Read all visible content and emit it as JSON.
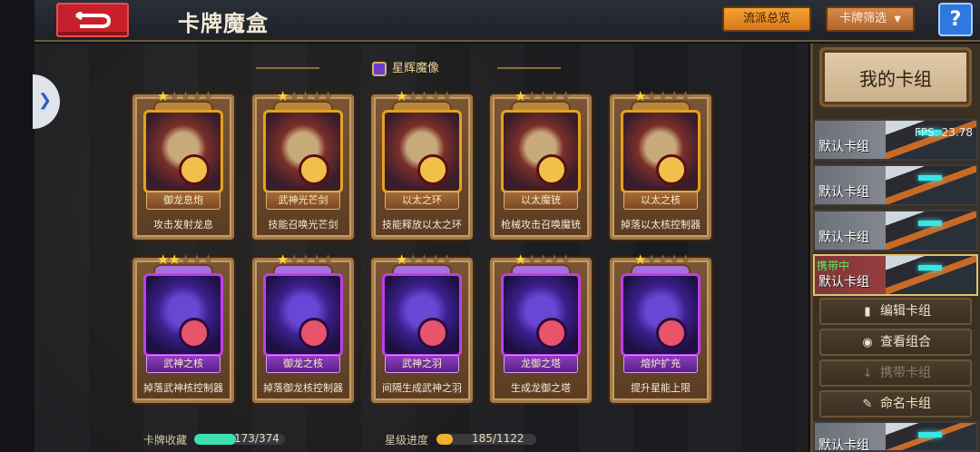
{
  "header": {
    "title": "卡牌魔盒",
    "school_overview_label": "流派总览",
    "card_filter_label": "卡牌筛选",
    "help_label": "?"
  },
  "section": {
    "title": "星辉魔像"
  },
  "cards": [
    {
      "name": "御龙息炮",
      "desc": "攻击发射龙息",
      "stars": 1,
      "rarity": "gold"
    },
    {
      "name": "武神光芒剑",
      "desc": "技能召唤光芒剑",
      "stars": 1,
      "rarity": "gold"
    },
    {
      "name": "以太之环",
      "desc": "技能释放以太之环",
      "stars": 1,
      "rarity": "gold"
    },
    {
      "name": "以太魔铳",
      "desc": "枪械攻击召唤魔铳",
      "stars": 1,
      "rarity": "gold"
    },
    {
      "name": "以太之核",
      "desc": "掉落以太核控制器",
      "stars": 1,
      "rarity": "gold"
    },
    {
      "name": "武神之核",
      "desc": "掉落武神核控制器",
      "stars": 2,
      "rarity": "purple"
    },
    {
      "name": "御龙之核",
      "desc": "掉落御龙核控制器",
      "stars": 1,
      "rarity": "purple"
    },
    {
      "name": "武神之羽",
      "desc": "间隔生成武神之羽",
      "stars": 1,
      "rarity": "purple"
    },
    {
      "name": "龙御之塔",
      "desc": "生成龙御之塔",
      "stars": 1,
      "rarity": "purple"
    },
    {
      "name": "熔炉扩充",
      "desc": "提升星能上限",
      "stars": 1,
      "rarity": "purple"
    }
  ],
  "progress": {
    "collection_label": "卡牌收藏",
    "collection_value": "173/374",
    "collection_fraction": 0.4626,
    "star_label": "星级进度",
    "star_value": "185/1122",
    "star_fraction": 0.1649,
    "collection_color": "#3ee0b0",
    "star_color": "#f0b030"
  },
  "sidebar": {
    "title": "我的卡组",
    "decks": [
      {
        "label": "默认卡组",
        "carrying": ""
      },
      {
        "label": "默认卡组",
        "carrying": ""
      },
      {
        "label": "默认卡组",
        "carrying": ""
      },
      {
        "label": "默认卡组",
        "carrying": "携带中"
      },
      {
        "label": "默认卡组",
        "carrying": ""
      }
    ],
    "fps": "FPS: 23.78",
    "edit_label": "编辑卡组",
    "view_label": "查看组合",
    "carry_label": "携带卡组",
    "rename_label": "命名卡组"
  }
}
